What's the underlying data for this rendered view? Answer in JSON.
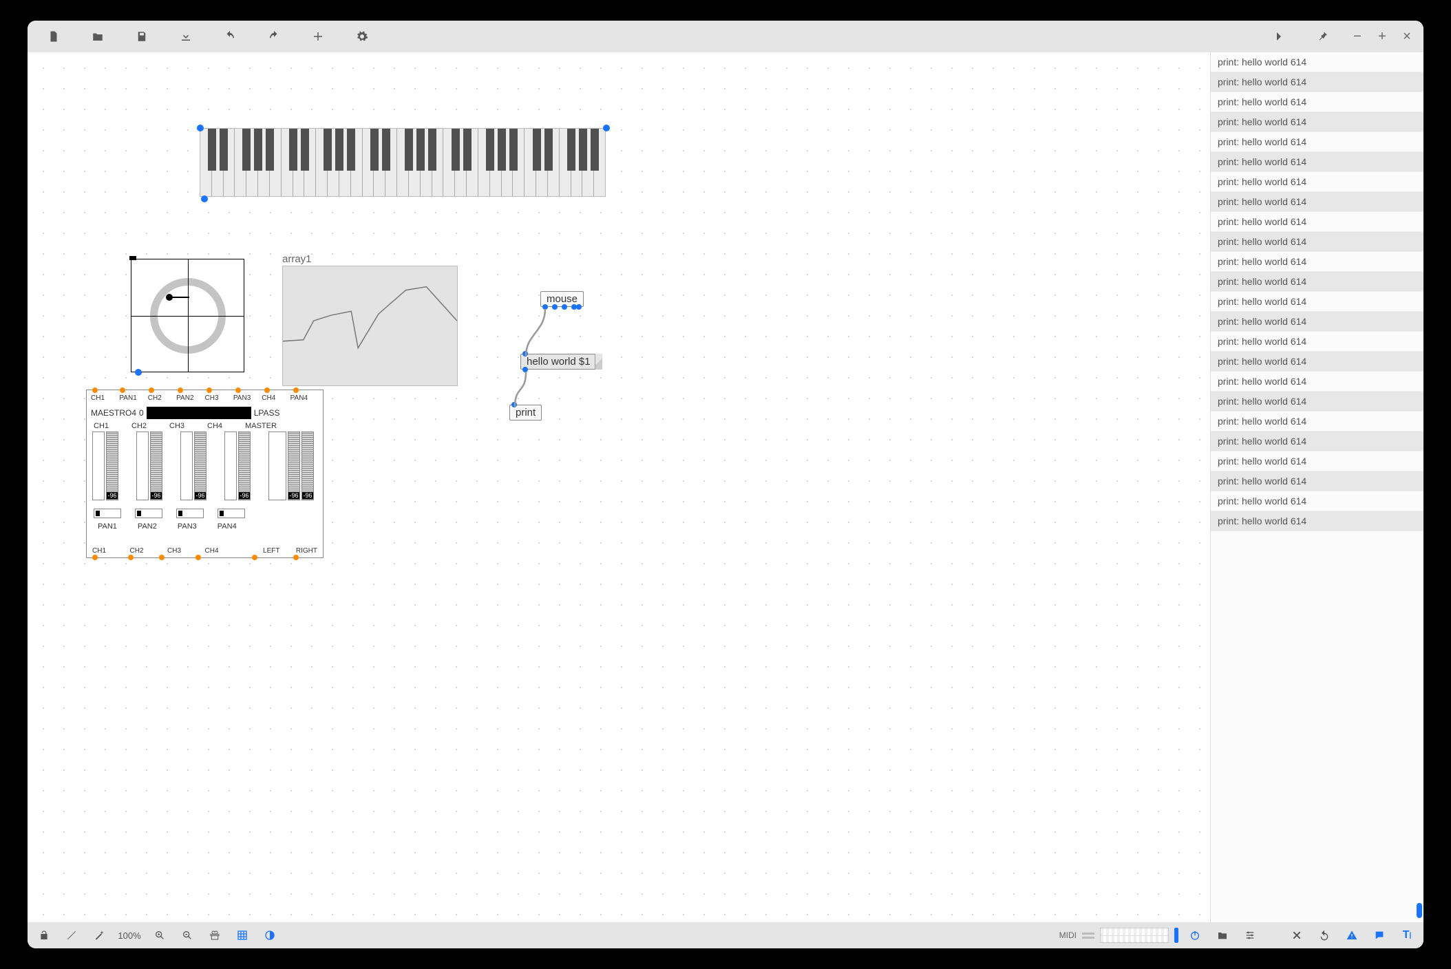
{
  "toolbar": {
    "new": "New",
    "folder": "Open",
    "save": "Save",
    "download": "Download",
    "undo": "Undo",
    "redo": "Redo",
    "add": "Add",
    "settings": "Settings",
    "forward": "Forward",
    "pin": "Pin",
    "minimize": "−",
    "maximize": "+",
    "close": "×"
  },
  "bottom": {
    "lock": "unlock",
    "zoom": "100%",
    "midi": "MIDI"
  },
  "console_message": "print: hello world 614",
  "console_count": 24,
  "canvas": {
    "array_label": "array1",
    "nodes": {
      "mouse": "mouse",
      "msg": "hello world $1",
      "print": "print"
    },
    "mixer": {
      "top_ch": [
        "CH1",
        "PAN1",
        "CH2",
        "PAN2",
        "CH3",
        "PAN3",
        "CH4",
        "PAN4"
      ],
      "name": "MAESTRO4",
      "preset": "0",
      "filter": "LPASS",
      "ch_labels": [
        "CH1",
        "CH2",
        "CH3",
        "CH4",
        "MASTER"
      ],
      "fader_db": "-96",
      "pan_labels": [
        "PAN1",
        "PAN2",
        "PAN3",
        "PAN4"
      ],
      "bottom": [
        "CH1",
        "CH2",
        "CH3",
        "CH4",
        "LEFT",
        "RIGHT"
      ]
    }
  }
}
